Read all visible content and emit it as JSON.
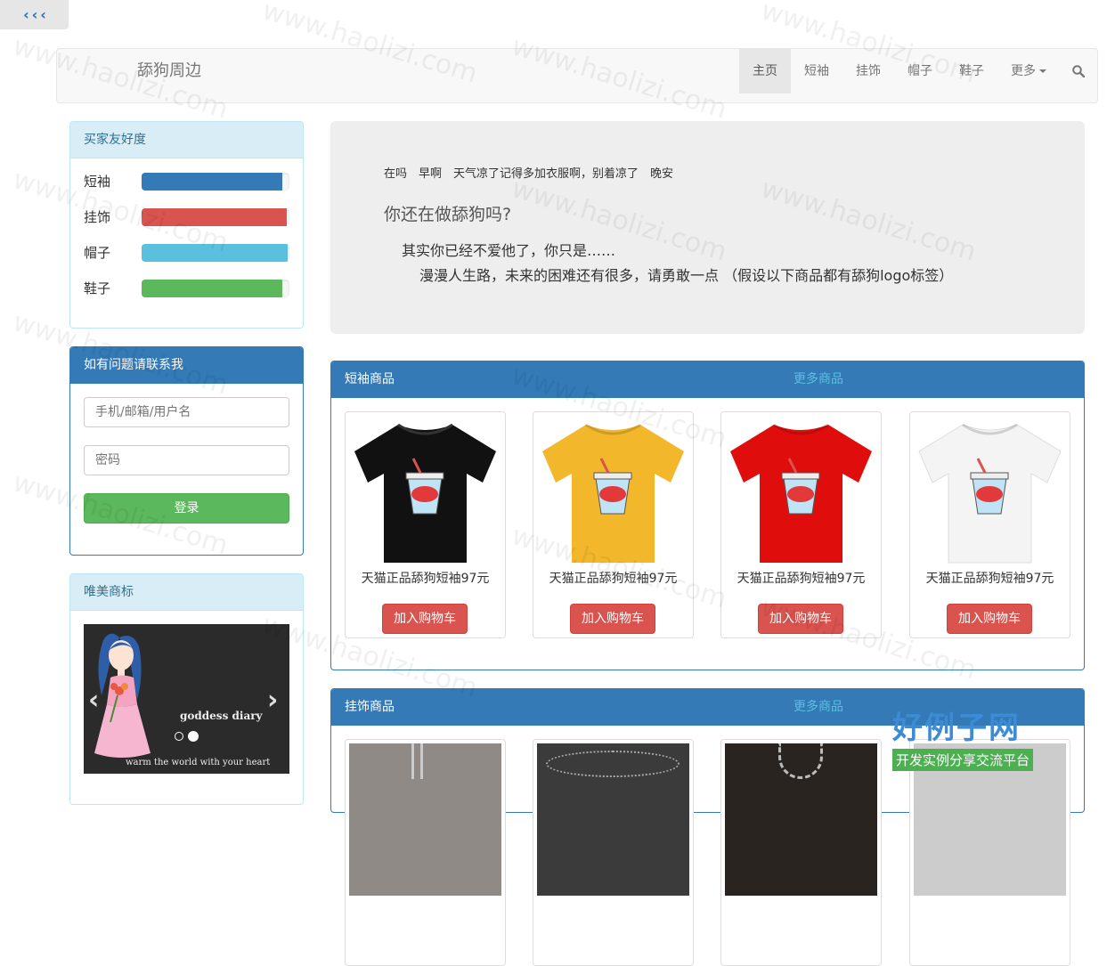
{
  "back": {
    "label": "< < <"
  },
  "navbar": {
    "brand": "舔狗周边",
    "items": [
      {
        "label": "主页",
        "active": true
      },
      {
        "label": "短袖"
      },
      {
        "label": "挂饰"
      },
      {
        "label": "帽子"
      },
      {
        "label": "鞋子"
      },
      {
        "label": "更多"
      }
    ]
  },
  "sidebar": {
    "ratings": {
      "title": "买家友好度",
      "items": [
        {
          "label": "短袖",
          "value": 0.95,
          "color": "#337ab7"
        },
        {
          "label": "挂饰",
          "value": 0.98,
          "color": "#d9534f"
        },
        {
          "label": "帽子",
          "value": 0.99,
          "color": "#5bc0de"
        },
        {
          "label": "鞋子",
          "value": 0.95,
          "color": "#5cb85c"
        }
      ]
    },
    "contact": {
      "title": "如有问题请联系我",
      "username_placeholder": "手机/邮箱/用户名",
      "password_placeholder": "密码",
      "login_label": "登录"
    },
    "logos": {
      "title": "唯美商标",
      "slide_title": "goddess diary",
      "slide_subtitle": "warm the world with your heart"
    }
  },
  "jumbotron": {
    "greeting": "在吗　早啊　天气凉了记得多加衣服啊，别着凉了　晚安",
    "question": "你还在做舔狗吗?",
    "line1": "其实你已经不爱他了，你只是……",
    "line2": "漫漫人生路，未来的困难还有很多，请勇敢一点 （假设以下商品都有舔狗logo标签）"
  },
  "sections": [
    {
      "title": "短袖商品",
      "more": "更多商品",
      "products": [
        {
          "name": "天猫正品舔狗短袖97元",
          "button": "加入购物车",
          "shirt_color": "#111111"
        },
        {
          "name": "天猫正品舔狗短袖97元",
          "button": "加入购物车",
          "shirt_color": "#f2b72b"
        },
        {
          "name": "天猫正品舔狗短袖97元",
          "button": "加入购物车",
          "shirt_color": "#e00d0d"
        },
        {
          "name": "天猫正品舔狗短袖97元",
          "button": "加入购物车",
          "shirt_color": "#f4f4f4"
        }
      ]
    },
    {
      "title": "挂饰商品",
      "more": "更多商品"
    }
  ],
  "watermark": {
    "text": "www.haolizi.com",
    "logo": "好例子网",
    "logo_sub": "开发实例分享交流平台"
  }
}
